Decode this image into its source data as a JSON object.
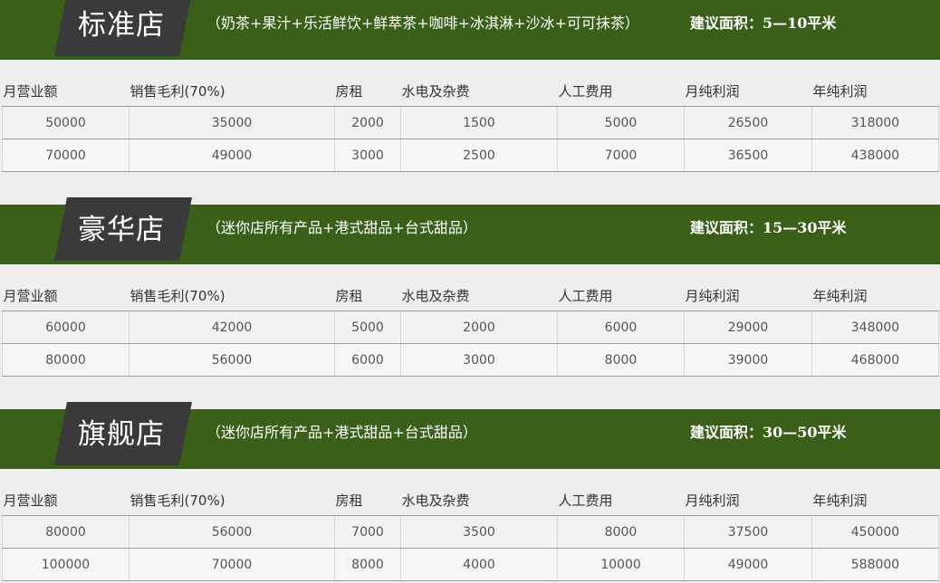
{
  "colors": {
    "banner": "#395f18",
    "tag": "#3a3a3a",
    "background": "#eeeeee"
  },
  "columns": [
    "月营业额",
    "销售毛利(70%)",
    "房租",
    "水电及杂费",
    "人工费用",
    "月纯利润",
    "年纯利润"
  ],
  "stores": [
    {
      "name": "标准店",
      "products": "（奶茶+果汁+乐活鲜饮+鲜萃茶+咖啡+冰淇淋+沙冰+可可抹茶）",
      "area": "建议面积：5—10平米",
      "rows": [
        [
          "50000",
          "35000",
          "2000",
          "1500",
          "5000",
          "26500",
          "318000"
        ],
        [
          "70000",
          "49000",
          "3000",
          "2500",
          "7000",
          "36500",
          "438000"
        ]
      ]
    },
    {
      "name": "豪华店",
      "products": "（迷你店所有产品+港式甜品+台式甜品）",
      "area": "建议面积：15—30平米",
      "rows": [
        [
          "60000",
          "42000",
          "5000",
          "2000",
          "6000",
          "29000",
          "348000"
        ],
        [
          "80000",
          "56000",
          "6000",
          "3000",
          "8000",
          "39000",
          "468000"
        ]
      ]
    },
    {
      "name": "旗舰店",
      "products": "（迷你店所有产品+港式甜品+台式甜品）",
      "area": "建议面积：30—50平米",
      "rows": [
        [
          "80000",
          "56000",
          "7000",
          "3500",
          "8000",
          "37500",
          "450000"
        ],
        [
          "100000",
          "70000",
          "8000",
          "4000",
          "10000",
          "49000",
          "588000"
        ]
      ]
    }
  ]
}
